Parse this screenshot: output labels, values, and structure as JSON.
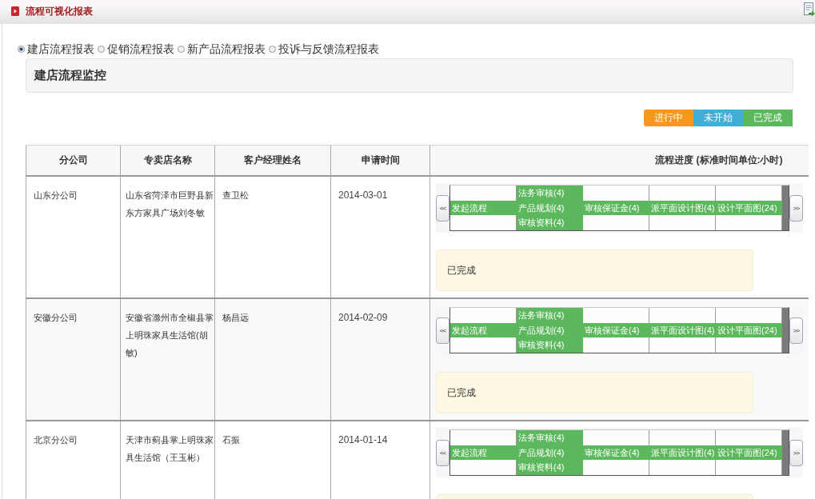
{
  "header": {
    "title": "流程可视化报表"
  },
  "report_types": [
    {
      "label": "建店流程报表",
      "selected": true
    },
    {
      "label": "促销流程报表",
      "selected": false
    },
    {
      "label": "新产品流程报表",
      "selected": false
    },
    {
      "label": "投诉与反馈流程报表",
      "selected": false
    }
  ],
  "panel": {
    "title": "建店流程监控"
  },
  "legend": [
    {
      "label": "进行中",
      "color": "#f7971c"
    },
    {
      "label": "未开始",
      "color": "#3fafd7"
    },
    {
      "label": "已完成",
      "color": "#5cb85c"
    }
  ],
  "table": {
    "columns": [
      "分公司",
      "专卖店名称",
      "客户经理姓名",
      "申请时间",
      "流程进度 (标准时间单位:小时)"
    ],
    "rows": [
      {
        "branch": "山东分公司",
        "store": "山东省菏泽市巨野县新东方家具广场刘冬敏",
        "manager": "查卫松",
        "date": "2014-03-01",
        "flow": {
          "prev": "<<",
          "stages": [
            {
              "tasks": [
                "发起流程"
              ],
              "color": "#5cb85c"
            },
            {
              "tasks": [
                "法务审核(4)",
                "产品规划(4)",
                "审核资料(4)"
              ],
              "color": "#5cb85c"
            },
            {
              "tasks": [
                "审核保证金(4)"
              ],
              "color": "#5cb85c"
            },
            {
              "tasks": [
                "派平面设计图(4)"
              ],
              "color": "#5cb85c"
            },
            {
              "tasks": [
                "设计平面图(24)"
              ],
              "color": "#5cb85c"
            }
          ],
          "next": ">>"
        },
        "status_note": "已完成"
      },
      {
        "branch": "安徽分公司",
        "store": "安徽省滁州市全椒县掌上明珠家具生活馆(胡敏)",
        "manager": "杨昌远",
        "date": "2014-02-09",
        "flow": {
          "prev": "<<",
          "stages": [
            {
              "tasks": [
                "发起流程"
              ],
              "color": "#5cb85c"
            },
            {
              "tasks": [
                "法务审核(4)",
                "产品规划(4)",
                "审核资料(4)"
              ],
              "color": "#5cb85c"
            },
            {
              "tasks": [
                "审核保证金(4)"
              ],
              "color": "#5cb85c"
            },
            {
              "tasks": [
                "派平面设计图(4)"
              ],
              "color": "#5cb85c"
            },
            {
              "tasks": [
                "设计平面图(24)"
              ],
              "color": "#5cb85c"
            }
          ],
          "next": ">>"
        },
        "status_note": "已完成"
      },
      {
        "branch": "北京分公司",
        "store": "天津市蓟县掌上明珠家具生活馆（王玉彬）",
        "manager": "石振",
        "date": "2014-01-14",
        "flow": {
          "prev": "<<",
          "stages": [
            {
              "tasks": [
                "发起流程"
              ],
              "color": "#5cb85c"
            },
            {
              "tasks": [
                "法务审核(4)",
                "产品规划(4)",
                "审核资料(4)"
              ],
              "color": "#5cb85c"
            },
            {
              "tasks": [
                "审核保证金(4)"
              ],
              "color": "#5cb85c"
            },
            {
              "tasks": [
                "派平面设计图(4)"
              ],
              "color": "#5cb85c"
            },
            {
              "tasks": [
                "设计平面图(24)"
              ],
              "color": "#5cb85c"
            }
          ],
          "next": ">>"
        }
      }
    ]
  }
}
